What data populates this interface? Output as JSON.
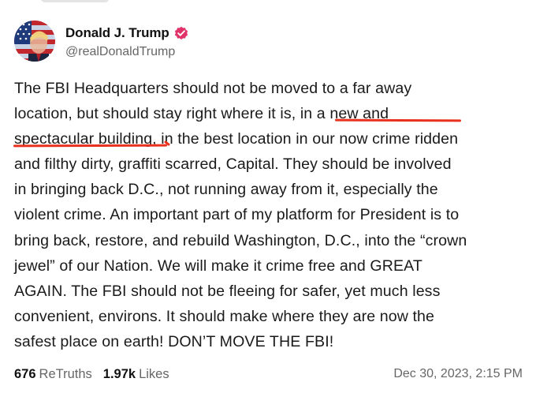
{
  "post": {
    "author": {
      "display_name": "Donald J. Trump",
      "handle": "@realDonaldTrump",
      "verified_icon": "verified-badge-icon",
      "verified_color": "#e0336a"
    },
    "body_lines": [
      "The FBI Headquarters should not be moved to a far away",
      "location, but should stay right where it is, in a new and",
      "spectacular building, in the best location in our now crime ridden",
      "and filthy dirty, graffiti scarred, Capital. They should be involved",
      "in bringing back D.C., not running away from it, especially the",
      "violent crime. An important part of my platform for President is to",
      "bring back, restore, and rebuild Washington, D.C., into the “crown",
      "jewel” of our Nation. We will make it crime free and GREAT",
      "AGAIN. The FBI should not be fleeing for safer, yet much less",
      "convenient, environs. It should make where they are now the",
      "safest place on earth! DON’T MOVE THE FBI!"
    ],
    "annotation": {
      "highlighted_text": "in a new and spectacular building",
      "underline_color": "#e8321f"
    },
    "stats": {
      "retruths_count": "676",
      "retruths_label": "ReTruths",
      "likes_count": "1.97k",
      "likes_label": "Likes"
    },
    "timestamp": "Dec 30, 2023, 2:15 PM"
  }
}
